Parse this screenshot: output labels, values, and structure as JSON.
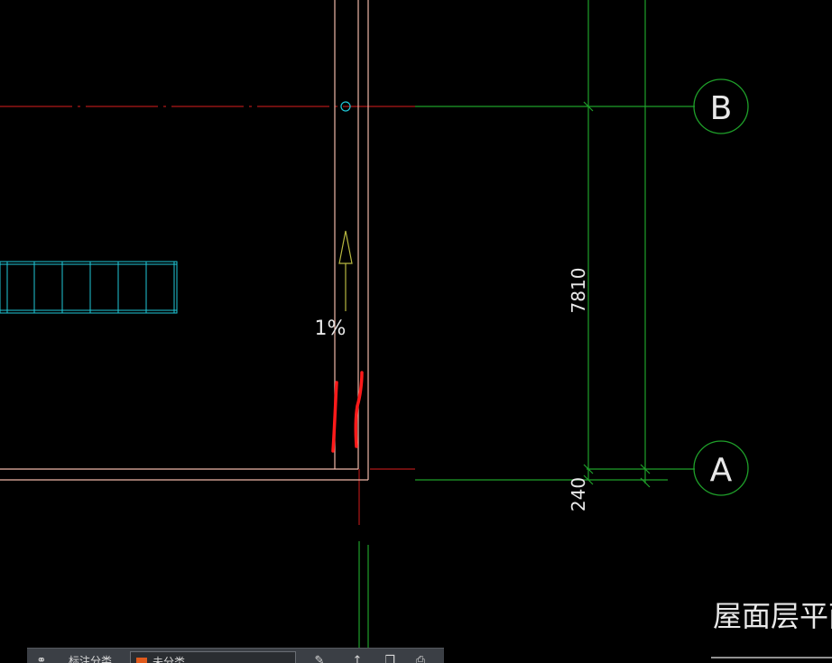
{
  "drawing": {
    "axis_labels": {
      "top": "B",
      "bottom": "A"
    },
    "dimensions": {
      "vertical": "7810",
      "bottom": "240"
    },
    "slope_label": "1%",
    "title_partial": "屋面层平面"
  },
  "status_bar": {
    "text_label": "标注分类",
    "layer_name": "未分类",
    "layer_color": "#e05a1c"
  },
  "colors": {
    "background": "#000000",
    "axis_red": "#b01818",
    "grid_green": "#1fa02a",
    "wall_pink": "#f0b8a8",
    "cyan_hatch": "#20c8d8",
    "arrow_olive": "#b8b840",
    "markup_red": "#ff1a1a",
    "text_white": "#e8e8e8"
  }
}
